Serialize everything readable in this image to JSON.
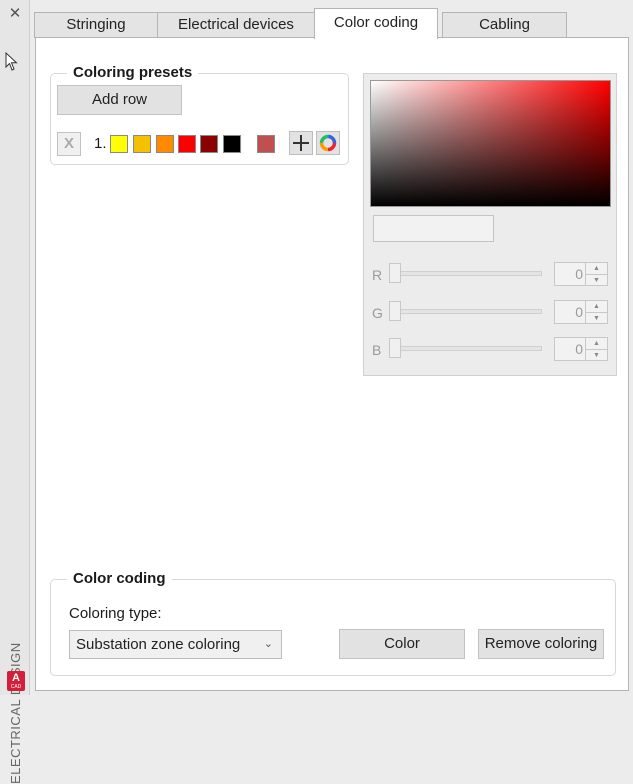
{
  "sidebar": {
    "vertical_title": "ELECTRICAL DESIGN",
    "close_glyph": "✕",
    "app_logo_letter": "A",
    "app_logo_sub": "CAD"
  },
  "tabs": [
    {
      "label": "Stringing",
      "active": false
    },
    {
      "label": "Electrical devices",
      "active": false
    },
    {
      "label": "Color coding",
      "active": true
    },
    {
      "label": "Cabling",
      "active": false
    }
  ],
  "presets": {
    "title": "Coloring presets",
    "add_row_label": "Add row",
    "rows": [
      {
        "delete_label": "X",
        "number": "1.",
        "swatches": [
          "#ffff00",
          "#f2c200",
          "#ff8a00",
          "#ff0000",
          "#8b0000",
          "#000000"
        ],
        "current_color": "#c0504d"
      }
    ]
  },
  "picker": {
    "hue_color": "#ff0000",
    "hex_value": "",
    "channels": [
      {
        "label": "R",
        "value": "0"
      },
      {
        "label": "G",
        "value": "0"
      },
      {
        "label": "B",
        "value": "0"
      }
    ]
  },
  "color_coding": {
    "title": "Color coding",
    "type_label": "Coloring type:",
    "type_value": "Substation zone coloring",
    "color_button": "Color",
    "remove_button": "Remove coloring"
  },
  "icons": {
    "close": "close-icon",
    "add": "plus-icon",
    "color_wheel": "color-wheel-icon",
    "dropdown": "chevron-down-icon",
    "spin_up": "arrow-up-icon",
    "spin_down": "arrow-down-icon",
    "pointer": "mouse-pointer-icon"
  }
}
